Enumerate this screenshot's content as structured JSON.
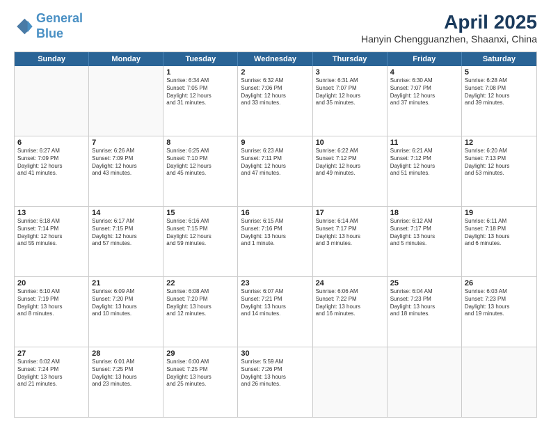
{
  "logo": {
    "line1": "General",
    "line2": "Blue"
  },
  "title": "April 2025",
  "subtitle": "Hanyin Chengguanzhen, Shaanxi, China",
  "days": [
    "Sunday",
    "Monday",
    "Tuesday",
    "Wednesday",
    "Thursday",
    "Friday",
    "Saturday"
  ],
  "rows": [
    [
      {
        "day": "",
        "content": ""
      },
      {
        "day": "",
        "content": ""
      },
      {
        "day": "1",
        "content": "Sunrise: 6:34 AM\nSunset: 7:05 PM\nDaylight: 12 hours\nand 31 minutes."
      },
      {
        "day": "2",
        "content": "Sunrise: 6:32 AM\nSunset: 7:06 PM\nDaylight: 12 hours\nand 33 minutes."
      },
      {
        "day": "3",
        "content": "Sunrise: 6:31 AM\nSunset: 7:07 PM\nDaylight: 12 hours\nand 35 minutes."
      },
      {
        "day": "4",
        "content": "Sunrise: 6:30 AM\nSunset: 7:07 PM\nDaylight: 12 hours\nand 37 minutes."
      },
      {
        "day": "5",
        "content": "Sunrise: 6:28 AM\nSunset: 7:08 PM\nDaylight: 12 hours\nand 39 minutes."
      }
    ],
    [
      {
        "day": "6",
        "content": "Sunrise: 6:27 AM\nSunset: 7:09 PM\nDaylight: 12 hours\nand 41 minutes."
      },
      {
        "day": "7",
        "content": "Sunrise: 6:26 AM\nSunset: 7:09 PM\nDaylight: 12 hours\nand 43 minutes."
      },
      {
        "day": "8",
        "content": "Sunrise: 6:25 AM\nSunset: 7:10 PM\nDaylight: 12 hours\nand 45 minutes."
      },
      {
        "day": "9",
        "content": "Sunrise: 6:23 AM\nSunset: 7:11 PM\nDaylight: 12 hours\nand 47 minutes."
      },
      {
        "day": "10",
        "content": "Sunrise: 6:22 AM\nSunset: 7:12 PM\nDaylight: 12 hours\nand 49 minutes."
      },
      {
        "day": "11",
        "content": "Sunrise: 6:21 AM\nSunset: 7:12 PM\nDaylight: 12 hours\nand 51 minutes."
      },
      {
        "day": "12",
        "content": "Sunrise: 6:20 AM\nSunset: 7:13 PM\nDaylight: 12 hours\nand 53 minutes."
      }
    ],
    [
      {
        "day": "13",
        "content": "Sunrise: 6:18 AM\nSunset: 7:14 PM\nDaylight: 12 hours\nand 55 minutes."
      },
      {
        "day": "14",
        "content": "Sunrise: 6:17 AM\nSunset: 7:15 PM\nDaylight: 12 hours\nand 57 minutes."
      },
      {
        "day": "15",
        "content": "Sunrise: 6:16 AM\nSunset: 7:15 PM\nDaylight: 12 hours\nand 59 minutes."
      },
      {
        "day": "16",
        "content": "Sunrise: 6:15 AM\nSunset: 7:16 PM\nDaylight: 13 hours\nand 1 minute."
      },
      {
        "day": "17",
        "content": "Sunrise: 6:14 AM\nSunset: 7:17 PM\nDaylight: 13 hours\nand 3 minutes."
      },
      {
        "day": "18",
        "content": "Sunrise: 6:12 AM\nSunset: 7:17 PM\nDaylight: 13 hours\nand 5 minutes."
      },
      {
        "day": "19",
        "content": "Sunrise: 6:11 AM\nSunset: 7:18 PM\nDaylight: 13 hours\nand 6 minutes."
      }
    ],
    [
      {
        "day": "20",
        "content": "Sunrise: 6:10 AM\nSunset: 7:19 PM\nDaylight: 13 hours\nand 8 minutes."
      },
      {
        "day": "21",
        "content": "Sunrise: 6:09 AM\nSunset: 7:20 PM\nDaylight: 13 hours\nand 10 minutes."
      },
      {
        "day": "22",
        "content": "Sunrise: 6:08 AM\nSunset: 7:20 PM\nDaylight: 13 hours\nand 12 minutes."
      },
      {
        "day": "23",
        "content": "Sunrise: 6:07 AM\nSunset: 7:21 PM\nDaylight: 13 hours\nand 14 minutes."
      },
      {
        "day": "24",
        "content": "Sunrise: 6:06 AM\nSunset: 7:22 PM\nDaylight: 13 hours\nand 16 minutes."
      },
      {
        "day": "25",
        "content": "Sunrise: 6:04 AM\nSunset: 7:23 PM\nDaylight: 13 hours\nand 18 minutes."
      },
      {
        "day": "26",
        "content": "Sunrise: 6:03 AM\nSunset: 7:23 PM\nDaylight: 13 hours\nand 19 minutes."
      }
    ],
    [
      {
        "day": "27",
        "content": "Sunrise: 6:02 AM\nSunset: 7:24 PM\nDaylight: 13 hours\nand 21 minutes."
      },
      {
        "day": "28",
        "content": "Sunrise: 6:01 AM\nSunset: 7:25 PM\nDaylight: 13 hours\nand 23 minutes."
      },
      {
        "day": "29",
        "content": "Sunrise: 6:00 AM\nSunset: 7:25 PM\nDaylight: 13 hours\nand 25 minutes."
      },
      {
        "day": "30",
        "content": "Sunrise: 5:59 AM\nSunset: 7:26 PM\nDaylight: 13 hours\nand 26 minutes."
      },
      {
        "day": "",
        "content": ""
      },
      {
        "day": "",
        "content": ""
      },
      {
        "day": "",
        "content": ""
      }
    ]
  ]
}
